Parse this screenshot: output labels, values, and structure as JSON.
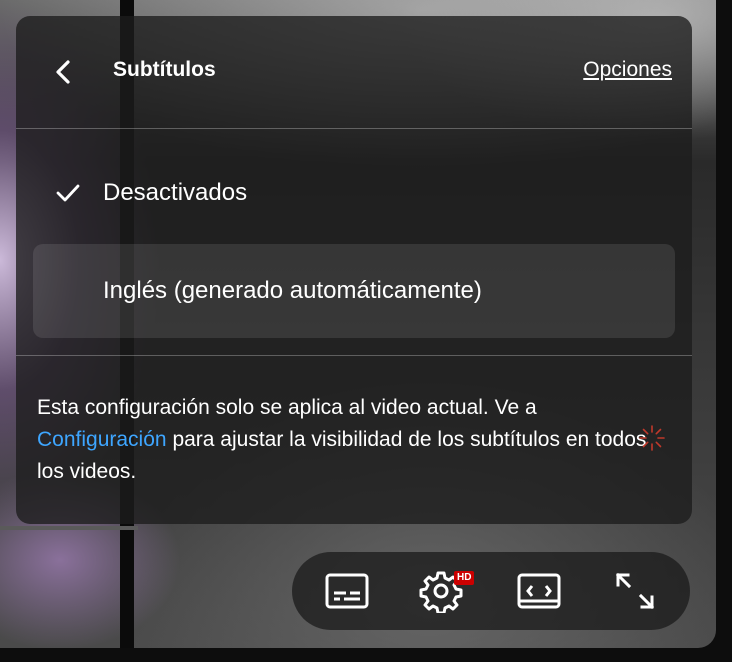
{
  "header": {
    "title": "Subtítulos",
    "options_label": "Opciones"
  },
  "items": [
    {
      "label": "Desactivados",
      "selected": true
    },
    {
      "label": "Inglés (generado automáticamente)",
      "selected": false
    }
  ],
  "info": {
    "text_before": "Esta configuración solo se aplica al video actual. Ve a",
    "link_label": "Configuración",
    "text_after": "para ajustar la visibilidad de los subtítulos en todos los videos."
  },
  "controls": {
    "buttons": [
      {
        "icon": "subtitles-icon"
      },
      {
        "icon": "settings-gear-icon",
        "badge": "HD"
      },
      {
        "icon": "theater-mode-icon"
      },
      {
        "icon": "fullscreen-icon"
      }
    ]
  },
  "colors": {
    "link": "#3ea6ff",
    "hd_badge": "#cc0000",
    "panel_bg": "rgba(28,28,28,0.78)"
  }
}
